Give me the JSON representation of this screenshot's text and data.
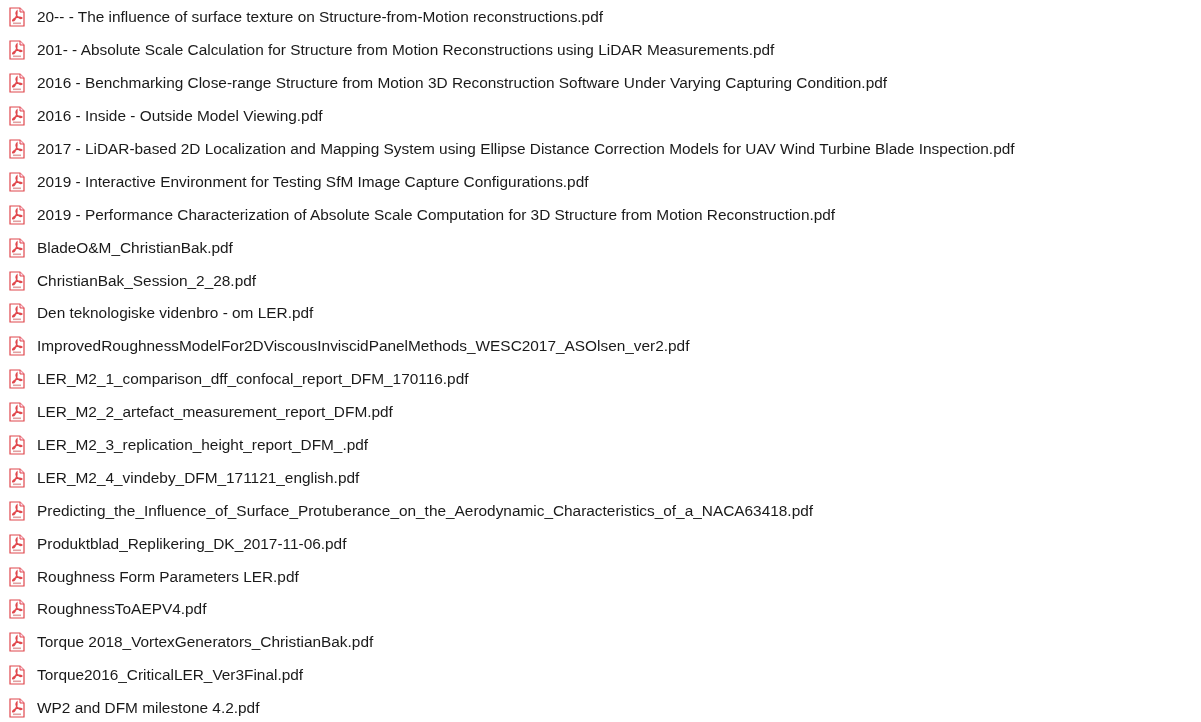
{
  "files": [
    {
      "name": "20-- - The influence of surface texture on Structure-from-Motion reconstructions.pdf"
    },
    {
      "name": "201- - Absolute Scale Calculation for Structure from Motion Reconstructions using LiDAR Measurements.pdf"
    },
    {
      "name": "2016 - Benchmarking Close-range Structure from Motion 3D Reconstruction Software Under Varying Capturing Condition.pdf"
    },
    {
      "name": "2016 - Inside - Outside Model Viewing.pdf"
    },
    {
      "name": "2017 - LiDAR-based 2D Localization and Mapping System using Ellipse Distance Correction Models for UAV Wind Turbine Blade Inspection.pdf"
    },
    {
      "name": "2019 - Interactive Environment for Testing SfM Image Capture Configurations.pdf"
    },
    {
      "name": "2019 - Performance Characterization of Absolute Scale Computation for 3D Structure from Motion Reconstruction.pdf"
    },
    {
      "name": "BladeO&M_ChristianBak.pdf"
    },
    {
      "name": "ChristianBak_Session_2_28.pdf"
    },
    {
      "name": "Den teknologiske videnbro - om LER.pdf"
    },
    {
      "name": "ImprovedRoughnessModelFor2DViscousInviscidPanelMethods_WESC2017_ASOlsen_ver2.pdf"
    },
    {
      "name": "LER_M2_1_comparison_dff_confocal_report_DFM_170116.pdf"
    },
    {
      "name": "LER_M2_2_artefact_measurement_report_DFM.pdf"
    },
    {
      "name": "LER_M2_3_replication_height_report_DFM_.pdf"
    },
    {
      "name": "LER_M2_4_vindeby_DFM_171121_english.pdf"
    },
    {
      "name": "Predicting_the_Influence_of_Surface_Protuberance_on_the_Aerodynamic_Characteristics_of_a_NACA63418.pdf"
    },
    {
      "name": "Produktblad_Replikering_DK_2017-11-06.pdf"
    },
    {
      "name": "Roughness Form Parameters LER.pdf"
    },
    {
      "name": "RoughnessToAEPV4.pdf"
    },
    {
      "name": "Torque 2018_VortexGenerators_ChristianBak.pdf"
    },
    {
      "name": "Torque2016_CriticalLER_Ver3Final.pdf"
    },
    {
      "name": "WP2 and DFM milestone 4.2.pdf"
    }
  ]
}
